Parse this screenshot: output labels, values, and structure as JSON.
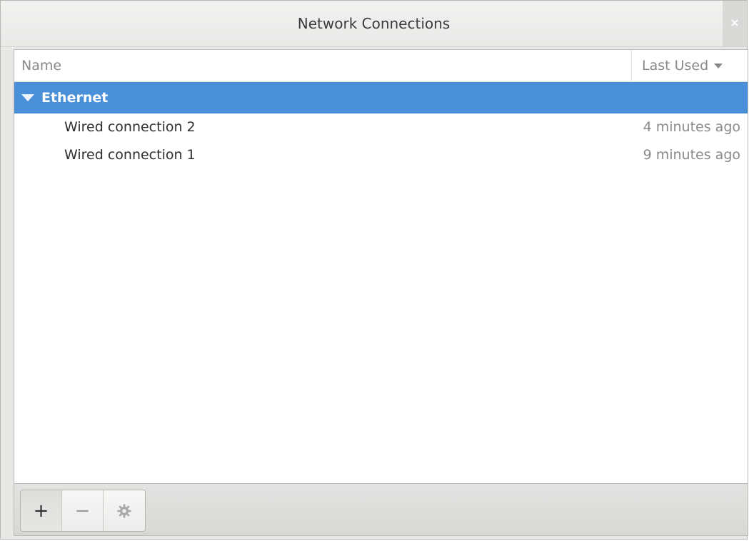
{
  "window": {
    "title": "Network Connections",
    "close_icon": "×"
  },
  "list": {
    "columns": {
      "name": "Name",
      "last_used": "Last Used"
    },
    "groups": [
      {
        "label": "Ethernet",
        "expanded": true,
        "selected": true,
        "items": [
          {
            "name": "Wired connection 2",
            "last_used": "4 minutes ago"
          },
          {
            "name": "Wired connection 1",
            "last_used": "9 minutes ago"
          }
        ]
      }
    ]
  },
  "toolbar": {
    "add_icon": "+",
    "remove_icon": "−",
    "settings_icon": "gear-icon"
  },
  "colors": {
    "selection": "#4a90d9",
    "dim_text": "#8a8a8a"
  }
}
